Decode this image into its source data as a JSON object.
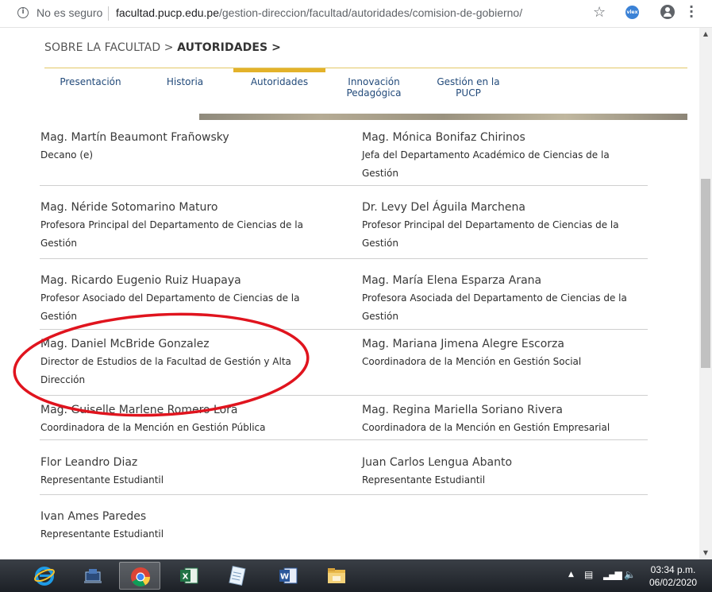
{
  "browser": {
    "security_label": "No es seguro",
    "url_host": "facultad.pucp.edu.pe",
    "url_path": "/gestion-direccion/facultad/autoridades/comision-de-gobierno/",
    "extension_label": "vlex"
  },
  "breadcrumb": {
    "part1": "SOBRE LA FACULTAD >",
    "part2": "AUTORIDADES >"
  },
  "tabs": [
    {
      "line1": "Presentación",
      "line2": ""
    },
    {
      "line1": "Historia",
      "line2": ""
    },
    {
      "line1": "Autoridades",
      "line2": ""
    },
    {
      "line1": "Innovación",
      "line2": "Pedagógica"
    },
    {
      "line1": "Gestión en la",
      "line2": "PUCP"
    }
  ],
  "active_tab": "Autoridades",
  "people": [
    {
      "name": "Mag. Martín Beaumont Frañowsky",
      "role": "Decano (e)"
    },
    {
      "name": "Mag. Mónica Bonifaz Chirinos",
      "role": "Jefa del Departamento Académico de Ciencias de la Gestión"
    },
    {
      "name": "Mag. Néride Sotomarino Maturo",
      "role": "Profesora Principal del Departamento de Ciencias de la Gestión"
    },
    {
      "name": "Dr. Levy Del Águila Marchena",
      "role": "Profesor Principal del Departamento de Ciencias de la Gestión"
    },
    {
      "name": "Mag. Ricardo Eugenio Ruiz Huapaya",
      "role": "Profesor Asociado del Departamento de Ciencias de la Gestión"
    },
    {
      "name": "Mag. María Elena Esparza Arana",
      "role": "Profesora Asociada del Departamento de Ciencias de la Gestión"
    },
    {
      "name": "Mag. Daniel McBride Gonzalez",
      "role": "Director de Estudios de la Facultad de Gestión y Alta Dirección"
    },
    {
      "name": "Mag. Mariana Jimena Alegre Escorza",
      "role": "Coordinadora de la Mención en Gestión Social"
    },
    {
      "name": "Mag. Guiselle Marlene Romero Lora",
      "role": "Coordinadora de la Mención en Gestión Pública"
    },
    {
      "name": "Mag. Regina Mariella Soriano Rivera",
      "role": "Coordinadora de la Mención en Gestión Empresarial"
    },
    {
      "name": "Flor Leandro Diaz",
      "role": "Representante Estudiantil"
    },
    {
      "name": "Juan Carlos Lengua Abanto",
      "role": "Representante Estudiantil"
    },
    {
      "name": "Ivan Ames Paredes",
      "role": "Representante Estudiantil"
    }
  ],
  "highlight": {
    "person": "Mag. Daniel McBride Gonzalez",
    "color": "#e0141e"
  },
  "colors": {
    "accent": "#e3b22a",
    "nav_text": "#224a7a",
    "divider": "#cfcfcf"
  },
  "taskbar": {
    "apps": [
      "internet-explorer-icon",
      "remote-desktop-icon",
      "chrome-icon",
      "excel-icon",
      "notepad-icon",
      "word-icon",
      "file-explorer-icon"
    ],
    "active_app": "chrome-icon",
    "clock_time": "03:34 p.m.",
    "clock_date": "06/02/2020"
  }
}
